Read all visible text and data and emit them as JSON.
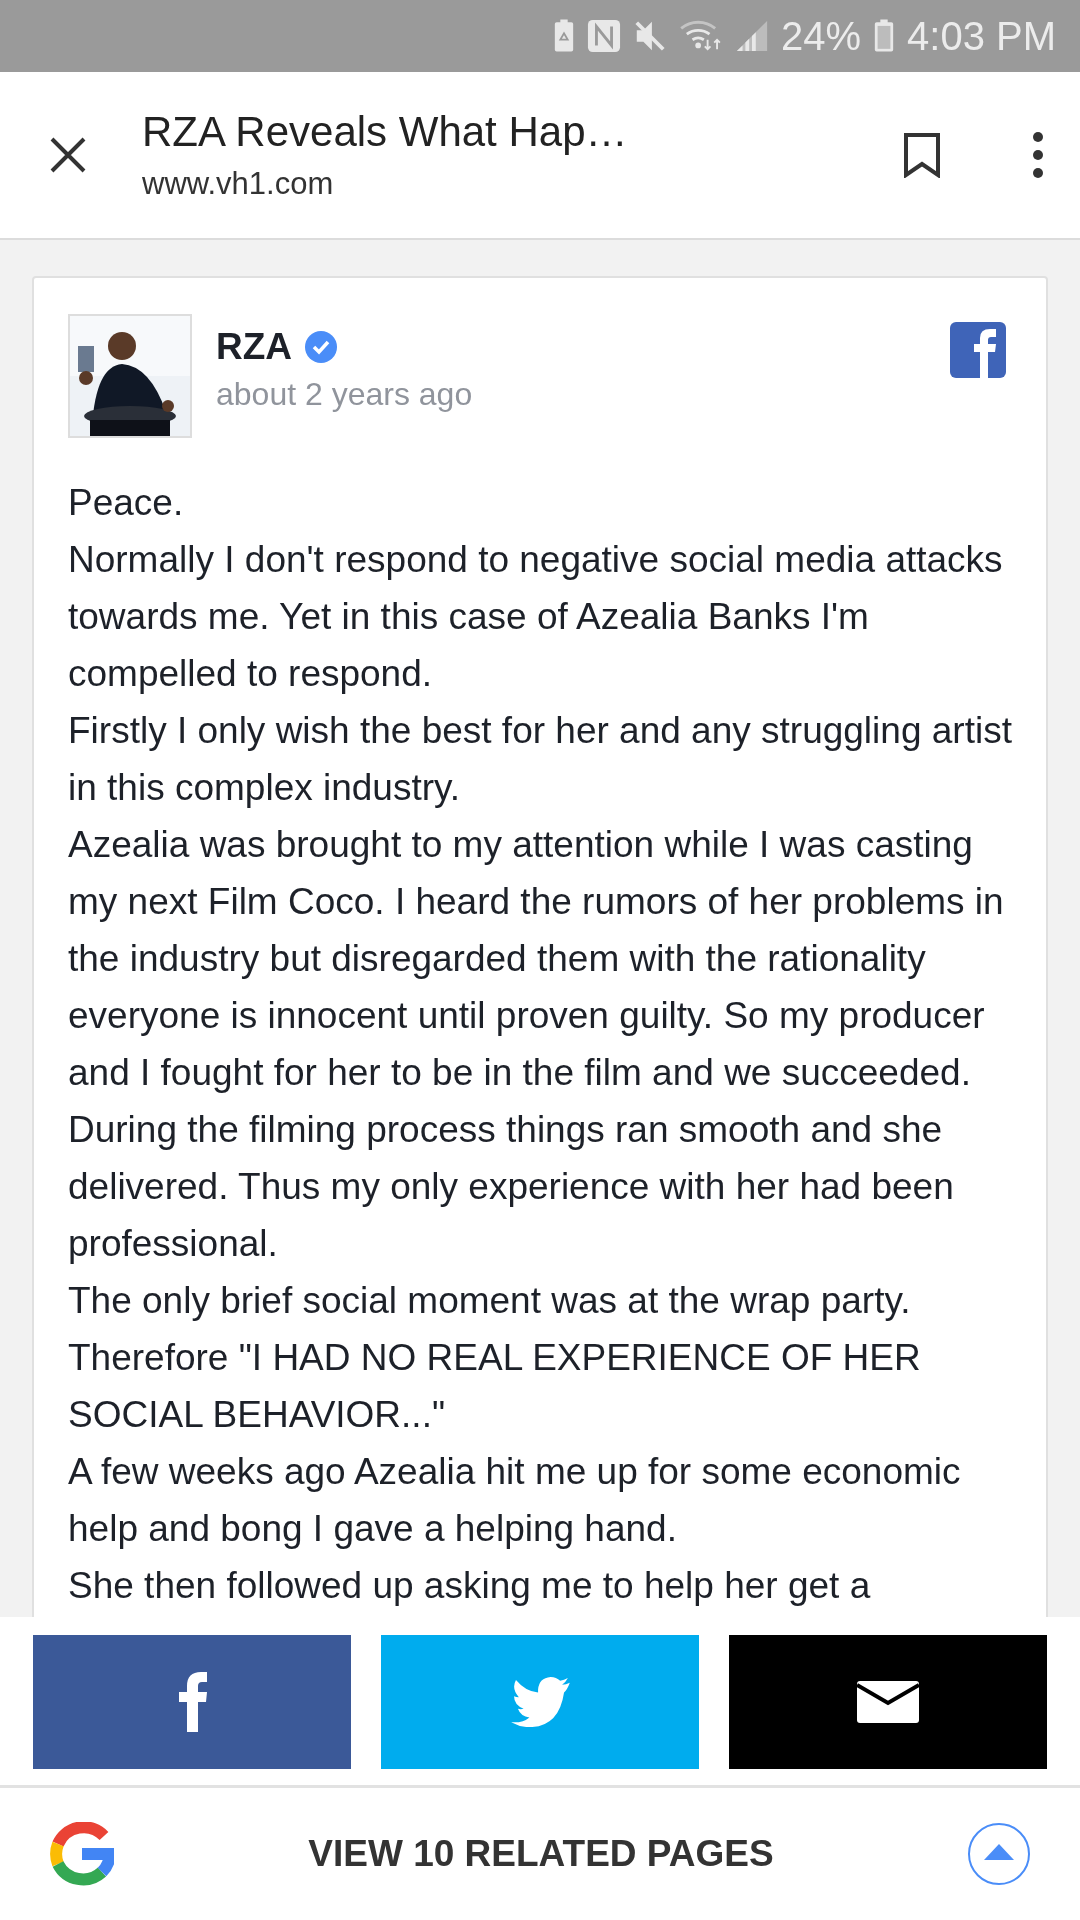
{
  "status_bar": {
    "battery_percent": "24%",
    "time": "4:03 PM"
  },
  "header": {
    "title": "RZA Reveals What Hap…",
    "url": "www.vh1.com"
  },
  "post": {
    "author": "RZA",
    "verified": true,
    "time": "about 2 years ago",
    "paragraphs": [
      "Peace.",
      "Normally I don't respond to negative social media attacks towards me. Yet in this case of Azealia Banks I'm compelled to respond.",
      "Firstly I only wish the best for her and any struggling artist in this complex industry.",
      "Azealia was brought to my attention while I was casting my next Film Coco. I heard the rumors of her problems in the industry but disregarded them with the rationality everyone is innocent until proven guilty. So my producer and I fought for her to be in the film and we succeeded. During the filming process things ran smooth and she delivered. Thus my only experience with her had been professional.",
      "The only brief social moment was at the wrap party.",
      "Therefore \"I HAD NO REAL EXPERIENCE OF HER SOCIAL BEHAVIOR...\"",
      "A few weeks ago Azealia hit me up for some economic help and bong I gave a helping hand.",
      "She then followed up asking me to help her get a"
    ]
  },
  "share_buttons": [
    {
      "kind": "facebook"
    },
    {
      "kind": "twitter"
    },
    {
      "kind": "email"
    }
  ],
  "bottom_bar": {
    "label": "VIEW 10 RELATED PAGES"
  }
}
